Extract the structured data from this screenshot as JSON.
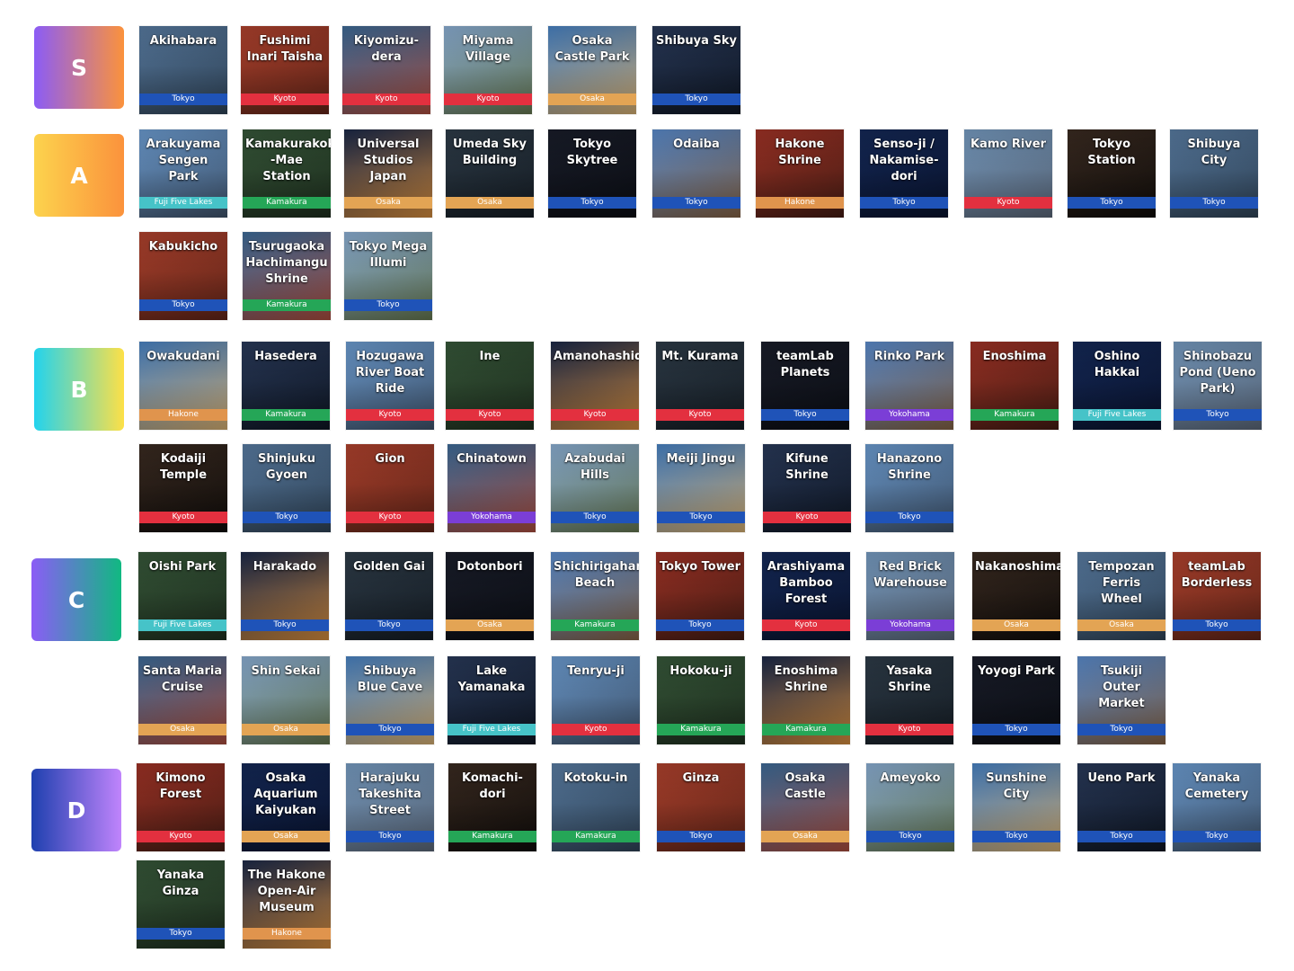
{
  "tiers": [
    {
      "label": "S",
      "items": [
        {
          "name": "Akihabara",
          "city": "Tokyo"
        },
        {
          "name": "Fushimi Inari Taisha",
          "city": "Kyoto"
        },
        {
          "name": "Kiyomizu-dera",
          "city": "Kyoto"
        },
        {
          "name": "Miyama Village",
          "city": "Kyoto"
        },
        {
          "name": "Osaka Castle Park",
          "city": "Osaka"
        },
        {
          "name": "Shibuya Sky",
          "city": "Tokyo"
        }
      ]
    },
    {
      "label": "A",
      "items": [
        {
          "name": "Arakuyama Sengen Park",
          "city": "Fuji Five Lakes"
        },
        {
          "name": "Kamakurakoko -Mae Station",
          "city": "Kamakura"
        },
        {
          "name": "Universal Studios Japan",
          "city": "Osaka"
        },
        {
          "name": "Umeda Sky Building",
          "city": "Osaka"
        },
        {
          "name": "Tokyo Skytree",
          "city": "Tokyo"
        },
        {
          "name": "Odaiba",
          "city": "Tokyo"
        },
        {
          "name": "Hakone Shrine",
          "city": "Hakone"
        },
        {
          "name": "Senso-ji / Nakamise-dori",
          "city": "Tokyo"
        },
        {
          "name": "Kamo River",
          "city": "Kyoto"
        },
        {
          "name": "Tokyo Station",
          "city": "Tokyo"
        },
        {
          "name": "Shibuya City",
          "city": "Tokyo"
        },
        {
          "name": "Kabukicho",
          "city": "Tokyo"
        },
        {
          "name": "Tsurugaoka Hachimangu Shrine",
          "city": "Kamakura"
        },
        {
          "name": "Tokyo Mega Illumi",
          "city": "Tokyo"
        }
      ]
    },
    {
      "label": "B",
      "items": [
        {
          "name": "Owakudani",
          "city": "Hakone"
        },
        {
          "name": "Hasedera",
          "city": "Kamakura"
        },
        {
          "name": "Hozugawa River Boat Ride",
          "city": "Kyoto"
        },
        {
          "name": "Ine",
          "city": "Kyoto"
        },
        {
          "name": "Amanohashidate",
          "city": "Kyoto"
        },
        {
          "name": "Mt. Kurama",
          "city": "Kyoto"
        },
        {
          "name": "teamLab Planets",
          "city": "Tokyo"
        },
        {
          "name": "Rinko Park",
          "city": "Yokohama"
        },
        {
          "name": "Enoshima",
          "city": "Kamakura"
        },
        {
          "name": "Oshino Hakkai",
          "city": "Fuji Five Lakes"
        },
        {
          "name": "Shinobazu Pond (Ueno Park)",
          "city": "Tokyo"
        },
        {
          "name": "Kodaiji Temple",
          "city": "Kyoto"
        },
        {
          "name": "Shinjuku Gyoen",
          "city": "Tokyo"
        },
        {
          "name": "Gion",
          "city": "Kyoto"
        },
        {
          "name": "Chinatown",
          "city": "Yokohama"
        },
        {
          "name": "Azabudai Hills",
          "city": "Tokyo"
        },
        {
          "name": "Meiji Jingu",
          "city": "Tokyo"
        },
        {
          "name": "Kifune Shrine",
          "city": "Kyoto"
        },
        {
          "name": "Hanazono Shrine",
          "city": "Tokyo"
        }
      ]
    },
    {
      "label": "C",
      "items": [
        {
          "name": "Oishi Park",
          "city": "Fuji Five Lakes"
        },
        {
          "name": "Harakado",
          "city": "Tokyo"
        },
        {
          "name": "Golden Gai",
          "city": "Tokyo"
        },
        {
          "name": "Dotonbori",
          "city": "Osaka"
        },
        {
          "name": "Shichirigahama Beach",
          "city": "Kamakura"
        },
        {
          "name": "Tokyo Tower",
          "city": "Tokyo"
        },
        {
          "name": "Arashiyama Bamboo Forest",
          "city": "Kyoto"
        },
        {
          "name": "Red Brick Warehouse",
          "city": "Yokohama"
        },
        {
          "name": "Nakanoshima",
          "city": "Osaka"
        },
        {
          "name": "Tempozan Ferris Wheel",
          "city": "Osaka"
        },
        {
          "name": "teamLab Borderless",
          "city": "Tokyo"
        },
        {
          "name": "Santa Maria Cruise",
          "city": "Osaka"
        },
        {
          "name": "Shin Sekai",
          "city": "Osaka"
        },
        {
          "name": "Shibuya Blue Cave",
          "city": "Tokyo"
        },
        {
          "name": "Lake Yamanaka",
          "city": "Fuji Five Lakes"
        },
        {
          "name": "Tenryu-ji",
          "city": "Kyoto"
        },
        {
          "name": "Hokoku-ji",
          "city": "Kamakura"
        },
        {
          "name": "Enoshima Shrine",
          "city": "Kamakura"
        },
        {
          "name": "Yasaka Shrine",
          "city": "Kyoto"
        },
        {
          "name": "Yoyogi Park",
          "city": "Tokyo"
        },
        {
          "name": "Tsukiji Outer Market",
          "city": "Tokyo"
        }
      ]
    },
    {
      "label": "D",
      "items": [
        {
          "name": "Kimono Forest",
          "city": "Kyoto"
        },
        {
          "name": "Osaka Aquarium Kaiyukan",
          "city": "Osaka"
        },
        {
          "name": "Harajuku Takeshita Street",
          "city": "Tokyo"
        },
        {
          "name": "Komachi-dori",
          "city": "Kamakura"
        },
        {
          "name": "Kotoku-in",
          "city": "Kamakura"
        },
        {
          "name": "Ginza",
          "city": "Tokyo"
        },
        {
          "name": "Osaka Castle",
          "city": "Osaka"
        },
        {
          "name": "Ameyoko",
          "city": "Tokyo"
        },
        {
          "name": "Sunshine City",
          "city": "Tokyo"
        },
        {
          "name": "Ueno Park",
          "city": "Tokyo"
        },
        {
          "name": "Yanaka Cemetery",
          "city": "Tokyo"
        },
        {
          "name": "Yanaka Ginza",
          "city": "Tokyo"
        },
        {
          "name": "The Hakone Open-Air Museum",
          "city": "Hakone"
        }
      ]
    }
  ],
  "city_colors": {
    "Tokyo": "#1f53b8",
    "Kyoto": "#e3303f",
    "Osaka": "#e3a454",
    "Fuji Five Lakes": "#46c3c8",
    "Kamakura": "#25a657",
    "Hakone": "#e0944d",
    "Yokohama": "#7b3ed6"
  }
}
